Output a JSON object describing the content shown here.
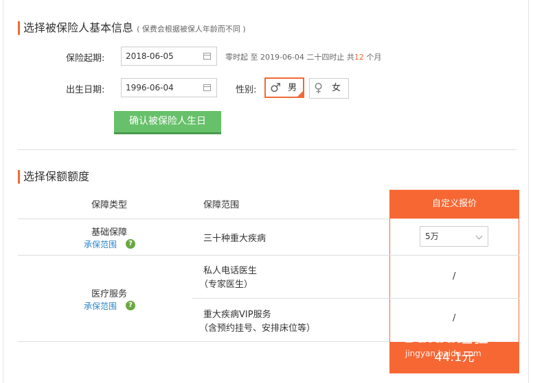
{
  "section1": {
    "title": "选择被保险人基本信息",
    "note": "( 保费会根据被保人年龄而不同 )"
  },
  "start": {
    "label": "保险起期:",
    "value": "2018-06-05",
    "prefix": "零时起 至 2019-06-04 二十四时止 共",
    "months": "12",
    "suffix": "个月"
  },
  "birth": {
    "label": "出生日期:",
    "value": "1996-06-04"
  },
  "gender": {
    "label": "性别:",
    "male": "男",
    "female": "女",
    "male_symbol": "♂",
    "female_symbol": "♀",
    "selected": "男"
  },
  "confirm_button": "确认被保险人生日",
  "section2": {
    "title": "选择保额额度"
  },
  "table": {
    "headers": {
      "type": "保障类型",
      "scope": "保障范围",
      "custom": "自定义报价"
    },
    "basic": {
      "type": "基础保障",
      "link": "承保范围",
      "scope": "三十种重大疾病",
      "amount": "5万"
    },
    "medical": {
      "type": "医疗服务",
      "link": "承保范围",
      "item1_line1": "私人电话医生",
      "item1_line2": "（专家医生）",
      "item1_value": "/",
      "item2_line1": "重大疾病VIP服务",
      "item2_line2": "（含预约挂号、安排床位等）",
      "item2_value": "/"
    },
    "price": "44.1元"
  },
  "watermark": {
    "logo": "Baidu经验",
    "url": "jingyan.baidu.com"
  },
  "colors": {
    "accent": "#f76734",
    "button_green": "#67c06a",
    "link_blue": "#2d87c8"
  }
}
